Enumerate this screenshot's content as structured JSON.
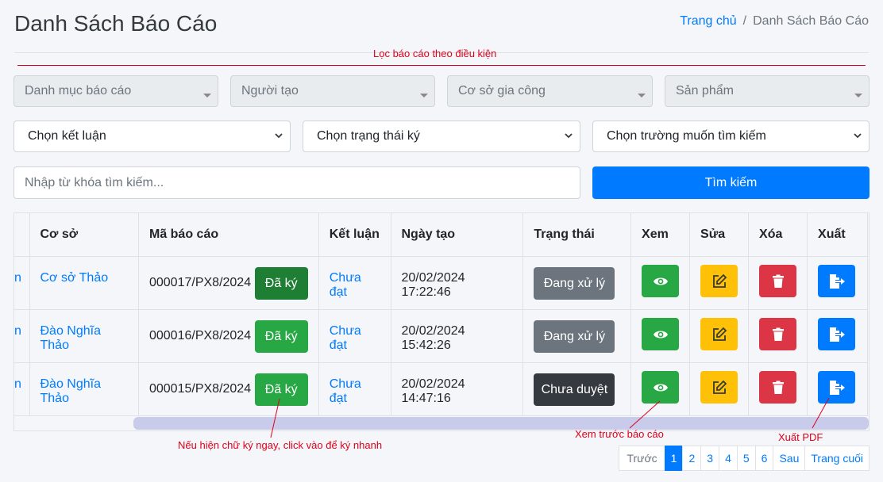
{
  "header": {
    "title": "Danh Sách Báo Cáo",
    "breadcrumb_home": "Trang chủ",
    "breadcrumb_sep": "/",
    "breadcrumb_current": "Danh Sách Báo Cáo"
  },
  "annotations": {
    "filter_note": "Lọc báo cáo theo điều kiện",
    "sign_note": "Nếu hiện chữ ký ngay, click vào để ký nhanh",
    "preview_note": "Xem trước báo cáo",
    "export_note": "Xuất PDF",
    "color": "#e0001b"
  },
  "filters": {
    "category_placeholder": "Danh mục báo cáo",
    "creator_placeholder": "Người tạo",
    "facility_placeholder": "Cơ sở gia công",
    "product_placeholder": "Sản phẩm",
    "conclusion_select": "Chọn kết luận",
    "sign_status_select": "Chọn trạng thái ký",
    "field_select": "Chọn trường muốn tìm kiếm",
    "keyword_placeholder": "Nhập từ khóa tìm kiếm...",
    "search_button": "Tìm kiếm"
  },
  "table": {
    "columns": [
      "Cơ sở",
      "Mã báo cáo",
      "Kết luận",
      "Ngày tạo",
      "Trạng thái",
      "Xem",
      "Sửa",
      "Xóa",
      "Xuất"
    ],
    "first_col_fragment": "n",
    "rows": [
      {
        "facility": "Cơ sở Thảo",
        "code": "000017/PX8/2024",
        "sign": "Đã ký",
        "conclusion": "Chưa đạt",
        "created": "20/02/2024 17:22:46",
        "status": "Đang xử lý"
      },
      {
        "facility": "Đào Nghĩa Thảo",
        "code": "000016/PX8/2024",
        "sign": "Đã ký",
        "conclusion": "Chưa đạt",
        "created": "20/02/2024 15:42:26",
        "status": "Đang xử lý"
      },
      {
        "facility": "Đào Nghĩa Thảo",
        "code": "000015/PX8/2024",
        "sign": "Đã ký",
        "conclusion": "Chưa đạt",
        "created": "20/02/2024 14:47:16",
        "status": "Chưa duyệt"
      }
    ],
    "icons": {
      "view": "eye-icon",
      "edit": "edit-icon",
      "delete": "trash-icon",
      "export": "file-export-icon"
    }
  },
  "pagination": {
    "prev": "Trước",
    "pages": [
      "1",
      "2",
      "3",
      "4",
      "5",
      "6"
    ],
    "active_page": "1",
    "next": "Sau",
    "last": "Trang cuối"
  },
  "colors": {
    "primary": "#007bff",
    "success": "#28a745",
    "warning": "#ffc107",
    "danger": "#dc3545",
    "secondary": "#6c757d",
    "dark": "#343a40"
  }
}
